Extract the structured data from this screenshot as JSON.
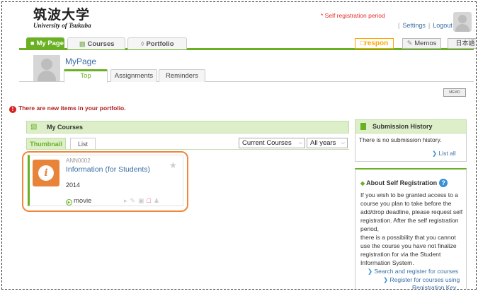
{
  "header": {
    "logo_jp": "筑波大学",
    "logo_en": "University of Tsukuba",
    "self_registration_notice": "* Self registration period",
    "settings_link": "Settings",
    "logout_link": "Logout",
    "separator": "|"
  },
  "nav": {
    "mypage": "My Page",
    "courses": "Courses",
    "portfolio": "Portfolio",
    "respon": "respon",
    "memos": "Memos",
    "language": "日本語"
  },
  "mypage": {
    "title": "MyPage",
    "tabs": [
      "Top",
      "Assignments",
      "Reminders"
    ]
  },
  "memo_icon_label": "MEMO",
  "alert": {
    "icon": "!",
    "text": "There are new items in your portfolio."
  },
  "my_courses": {
    "title": "My Courses",
    "view_tabs": [
      "Thumbnail",
      "List"
    ],
    "filter_selected": "Current Courses",
    "year_selected": "All years",
    "course": {
      "code": "ANN0002",
      "title": "Information (for Students)",
      "year": "2014",
      "material_label": "movie",
      "icon_letter": "i"
    }
  },
  "submission_history": {
    "title": "Submission History",
    "text": "There is no submission history.",
    "list_all": "List all"
  },
  "about": {
    "title": "About Self Registration",
    "lines": [
      "If you wish to be granted access to a",
      "course you plan to take before the",
      "add/drop deadline, please request self",
      "registration. After the self registration",
      "period,",
      "there is a possibility that you cannot",
      "use the course you have not finalize",
      "registration for via the Student",
      "Information System."
    ],
    "link1": "Search and register for courses",
    "link2_line1": "Register for courses using",
    "link2_line2": "Registration Key"
  },
  "colors": {
    "brand_green": "#6ab023",
    "link_blue": "#3a6ea5",
    "highlight_orange": "#f0873a",
    "alert_red": "#b01e1e"
  }
}
